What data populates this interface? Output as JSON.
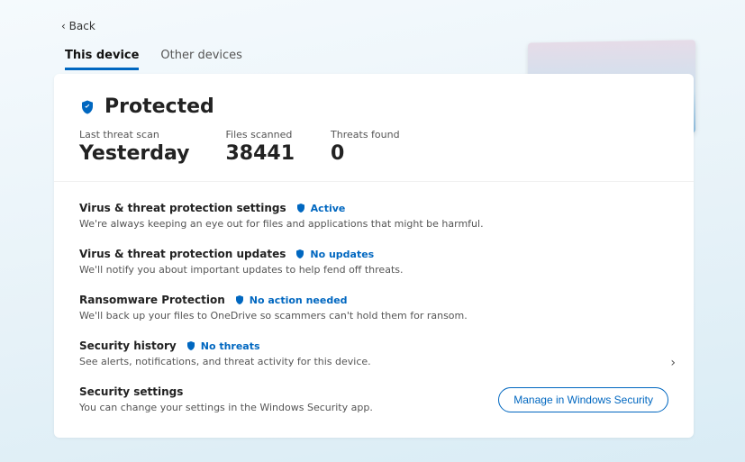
{
  "back_label": "Back",
  "tabs": [
    "This device",
    "Other devices"
  ],
  "active_tab": 0,
  "status": {
    "title": "Protected",
    "stats": [
      {
        "label": "Last threat scan",
        "value": "Yesterday"
      },
      {
        "label": "Files scanned",
        "value": "38441"
      },
      {
        "label": "Threats found",
        "value": "0"
      }
    ]
  },
  "sections": [
    {
      "title": "Virus & threat protection settings",
      "badge": "Active",
      "desc": "We're always keeping an eye out for files and applications that might be harmful."
    },
    {
      "title": "Virus & threat protection updates",
      "badge": "No updates",
      "desc": "We'll notify you about important updates to help fend off threats."
    },
    {
      "title": "Ransomware Protection",
      "badge": "No action needed",
      "desc": "We'll back up your files to OneDrive so scammers can't hold them for ransom."
    },
    {
      "title": "Security history",
      "badge": "No threats",
      "desc": "See alerts, notifications, and threat activity for this device.",
      "has_chevron": true
    }
  ],
  "footer": {
    "title": "Security settings",
    "desc": "You can change your settings in the Windows Security app.",
    "button": "Manage in Windows Security"
  },
  "colors": {
    "accent": "#0067c0"
  }
}
